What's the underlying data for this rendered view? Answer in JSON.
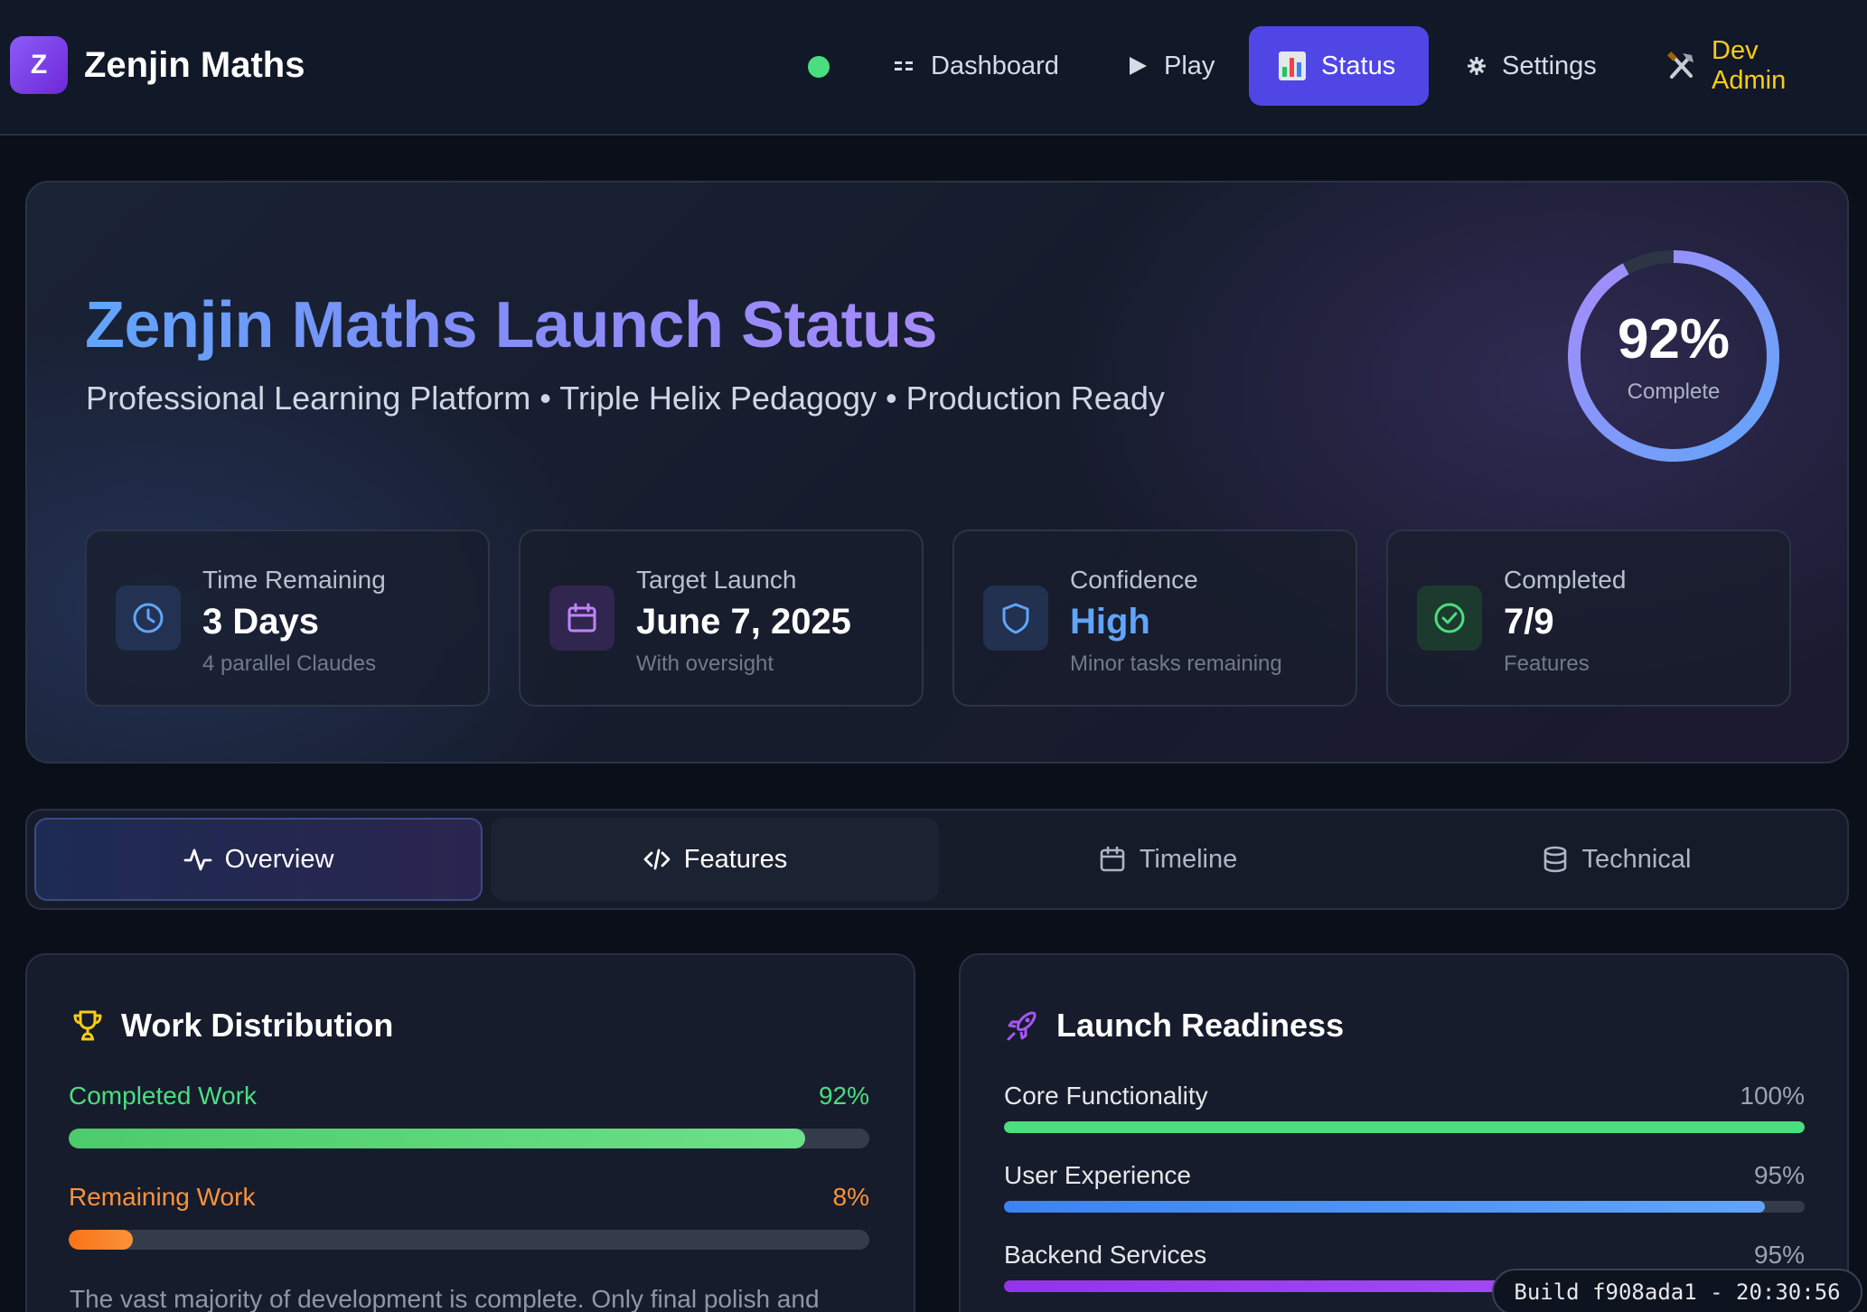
{
  "app": {
    "logo_letter": "Z",
    "title": "Zenjin Maths"
  },
  "nav": {
    "status_indicator_color": "#4ade80",
    "items": [
      {
        "label": "Dashboard",
        "icon": "grid-icon"
      },
      {
        "label": "Play",
        "icon": "play-icon"
      },
      {
        "label": "Status",
        "icon": "bar-chart-icon",
        "active": true
      },
      {
        "label": "Settings",
        "icon": "gear-icon"
      },
      {
        "label": "Dev Admin",
        "icon": "tools-icon",
        "color": "#facc15"
      }
    ]
  },
  "hero": {
    "title": "Zenjin Maths Launch Status",
    "subtitle": "Professional Learning Platform • Triple Helix Pedagogy • Production Ready",
    "progress": {
      "percent_text": "92%",
      "percent_value": 92,
      "label": "Complete"
    },
    "stats": [
      {
        "label": "Time Remaining",
        "value": "3 Days",
        "note": "4 parallel Claudes",
        "icon": "clock-icon"
      },
      {
        "label": "Target Launch",
        "value": "June 7, 2025",
        "note": "With oversight",
        "icon": "calendar-icon"
      },
      {
        "label": "Confidence",
        "value": "High",
        "note": "Minor tasks remaining",
        "icon": "shield-icon"
      },
      {
        "label": "Completed",
        "value": "7/9",
        "note": "Features",
        "icon": "check-circle-icon"
      }
    ]
  },
  "tabs": [
    {
      "label": "Overview",
      "icon": "activity-icon",
      "active": true
    },
    {
      "label": "Features",
      "icon": "code-icon"
    },
    {
      "label": "Timeline",
      "icon": "calendar-icon"
    },
    {
      "label": "Technical",
      "icon": "database-icon"
    }
  ],
  "work_distribution": {
    "title": "Work Distribution",
    "icon": "trophy-icon",
    "bars": [
      {
        "label": "Completed Work",
        "value_text": "92%",
        "value": 92,
        "color": "#4ade80"
      },
      {
        "label": "Remaining Work",
        "value_text": "8%",
        "value": 8,
        "color": "#fb923c"
      }
    ],
    "description": "The vast majority of development is complete. Only final polish and"
  },
  "launch_readiness": {
    "title": "Launch Readiness",
    "icon": "rocket-icon",
    "bars": [
      {
        "label": "Core Functionality",
        "value_text": "100%",
        "value": 100,
        "color": "#4ade80"
      },
      {
        "label": "User Experience",
        "value_text": "95%",
        "value": 95,
        "color": "#3b82f6"
      },
      {
        "label": "Backend Services",
        "value_text": "95%",
        "value": 95,
        "color": "#a855f7"
      }
    ]
  },
  "build": {
    "text": "Build f908ada1 - 20:30:56"
  }
}
